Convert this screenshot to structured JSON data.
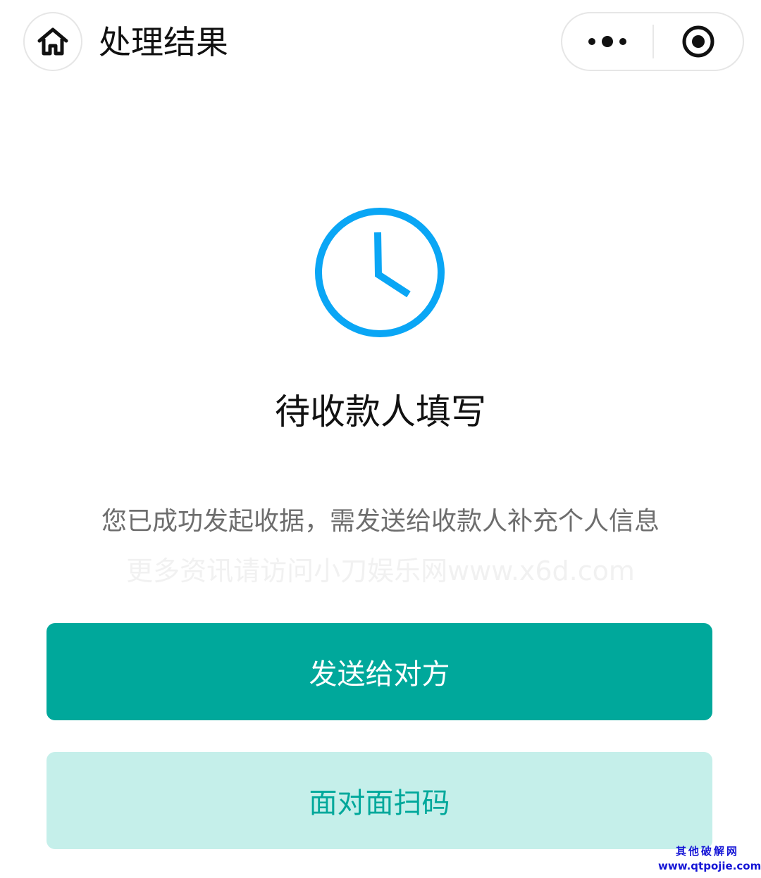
{
  "nav": {
    "title": "处理结果",
    "home_icon": "home-icon",
    "menu_icon": "more-dots-icon",
    "close_icon": "target-close-icon"
  },
  "status": {
    "icon": "clock-icon",
    "icon_color": "#0aa6f5",
    "title": "待收款人填写",
    "description": "您已成功发起收据，需发送给收款人补充个人信息",
    "watermark_text": "更多资讯请访问小刀娱乐网www.x6d.com"
  },
  "actions": {
    "primary_label": "发送给对方",
    "primary_color": "#00a89b",
    "secondary_label": "面对面扫码",
    "secondary_color": "#c5efea"
  },
  "corner_watermark": {
    "line1": "其他破解网",
    "line2": "www.qtpojie.com"
  }
}
